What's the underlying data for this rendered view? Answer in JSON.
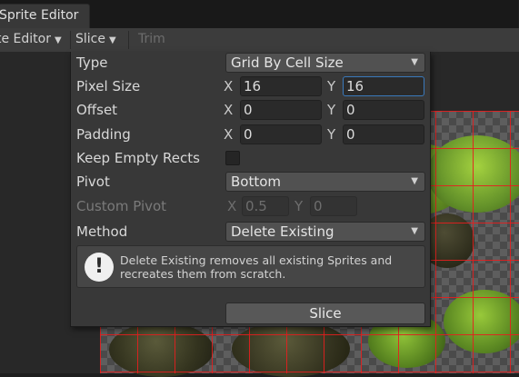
{
  "window": {
    "tab_title": "Sprite Editor"
  },
  "toolbar": {
    "mode": "te Editor",
    "slice": "Slice",
    "trim": "Trim"
  },
  "popup": {
    "type": {
      "label": "Type",
      "value": "Grid By Cell Size"
    },
    "pixel_size": {
      "label": "Pixel Size",
      "x": "16",
      "y": "16"
    },
    "offset": {
      "label": "Offset",
      "x": "0",
      "y": "0"
    },
    "padding": {
      "label": "Padding",
      "x": "0",
      "y": "0"
    },
    "keep_empty": {
      "label": "Keep Empty Rects",
      "checked": false
    },
    "pivot": {
      "label": "Pivot",
      "value": "Bottom"
    },
    "custom_pivot": {
      "label": "Custom Pivot",
      "x": "0.5",
      "y": "0"
    },
    "method": {
      "label": "Method",
      "value": "Delete Existing"
    },
    "axis": {
      "x": "X",
      "y": "Y"
    },
    "help": {
      "icon": "exclamation-icon",
      "text": "Delete Existing removes all existing Sprites and recreates them from scratch."
    },
    "slice_button": "Slice"
  },
  "colors": {
    "grid_line": "#e61e1e",
    "focus": "#3a79bb",
    "foliage": "#7cae2c"
  }
}
